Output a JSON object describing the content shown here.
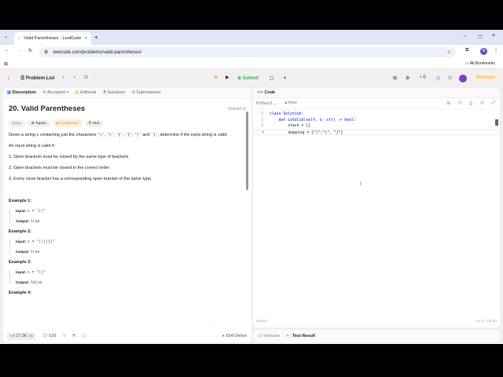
{
  "browser": {
    "tab_title": "Valid Parentheses - LeetCode",
    "url": "leetcode.com/problems/valid-parentheses/",
    "bookmarks": "All Bookmarks",
    "profile": "N"
  },
  "header": {
    "problem_list": "Problem List",
    "submit": "Submit",
    "streak": "0",
    "premium": "Premium"
  },
  "left_tabs": [
    "Description",
    "Accepted",
    "Editorial",
    "Solutions",
    "Submissions"
  ],
  "problem": {
    "title": "20. Valid Parentheses",
    "status": "Solved",
    "tags": [
      "Easy",
      "Topics",
      "Companies",
      "Hint"
    ],
    "intro_a": "Given a string",
    "intro_var": "s",
    "intro_b": "containing just the characters",
    "chars": [
      "'('",
      ", ",
      "')'",
      ", ",
      "'{'",
      ", ",
      "'}'",
      ", ",
      "'['",
      " and ",
      "']'"
    ],
    "intro_c": ", determine if the input string is valid.",
    "valid_if": "An input string is valid if:",
    "rules": [
      "1. Open brackets must be closed by the same type of brackets.",
      "2. Open brackets must be closed in the correct order.",
      "3. Every close bracket has a corresponding open bracket of the same type."
    ],
    "examples": [
      {
        "title": "Example 1:",
        "input": "s = \"()\"",
        "output": "true"
      },
      {
        "title": "Example 2:",
        "input": "s = \"()[]{}\"",
        "output": "true"
      },
      {
        "title": "Example 3:",
        "input": "s = \"(]\"",
        "output": "false"
      }
    ],
    "example4": "Example 4:",
    "input_label": "Input:",
    "output_label": "Output:"
  },
  "footer": {
    "likes": "27.3K",
    "comments": "629",
    "online": "554 Online"
  },
  "code": {
    "tab": "Code",
    "language": "Python3",
    "mode": "Auto",
    "lines": [
      "class Solution:",
      "    def isValid(self, s: str) -> bool:",
      "        stack = []",
      "        mapping = {\")\":\"(\", \"}\"}"
    ],
    "status": "Saved",
    "cursor": "Ln 4, Col 32"
  },
  "bottom_tabs": [
    "Testcase",
    "Test Result"
  ]
}
